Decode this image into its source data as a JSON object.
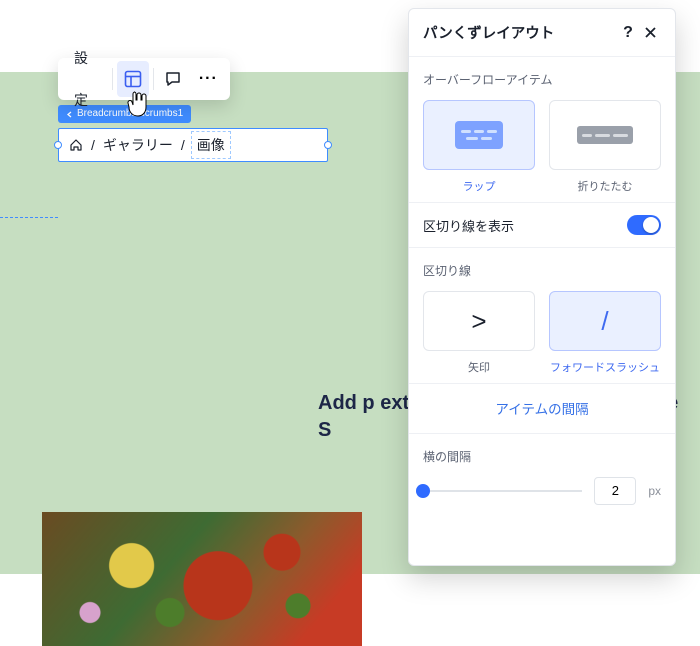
{
  "toolbar": {
    "settings": "設定"
  },
  "selection_tag": {
    "text": "Breadcrumbs       dcrumbs1"
  },
  "breadcrumb": {
    "gallery": "ギャラリー",
    "current": "画像",
    "slash": "/"
  },
  "body_text": "Add p                                   ext\" to up                                   e. To chanç                                   ›o to Site S",
  "panel": {
    "title": "パンくずレイアウト",
    "overflow_label": "オーバーフローアイテム",
    "overflow_options": {
      "wrap": "ラップ",
      "fold": "折りたたむ"
    },
    "show_separator_label": "区切り線を表示",
    "separator_label": "区切り線",
    "separator_options": {
      "arrow": "矢印",
      "slash": "フォワードスラッシュ",
      "arrow_glyph": ">",
      "slash_glyph": "/"
    },
    "item_spacing_link": "アイテムの間隔",
    "horizontal_spacing_label": "横の間隔",
    "horizontal_spacing_value": "2",
    "horizontal_spacing_unit": "px"
  }
}
